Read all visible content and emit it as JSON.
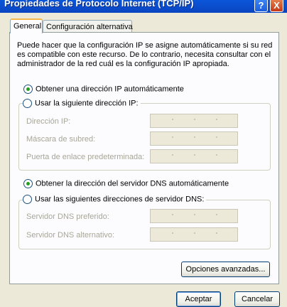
{
  "window": {
    "title": "Propiedades de Protocolo Internet (TCP/IP)",
    "help_glyph": "?",
    "close_glyph": "X"
  },
  "tabs": [
    {
      "label": "General",
      "active": true
    },
    {
      "label": "Configuración alternativa",
      "active": false
    }
  ],
  "description": "Puede hacer que la configuración IP se asigne automáticamente si su red es compatible con este recurso. De lo contrario, necesita consultar con el administrador de la red cuál es la configuración IP apropiada.",
  "ip_options": {
    "auto_label": "Obtener una dirección IP automáticamente",
    "auto_selected": true,
    "manual_label": "Usar la siguiente dirección IP:",
    "manual_selected": false,
    "fields": [
      {
        "label": "Dirección IP:",
        "value": ""
      },
      {
        "label": "Máscara de subred:",
        "value": ""
      },
      {
        "label": "Puerta de enlace predeterminada:",
        "value": ""
      }
    ]
  },
  "dns_options": {
    "auto_label": "Obtener la dirección del servidor DNS automáticamente",
    "auto_selected": true,
    "manual_label": "Usar las siguientes direcciones de servidor DNS:",
    "manual_selected": false,
    "fields": [
      {
        "label": "Servidor DNS preferido:",
        "value": ""
      },
      {
        "label": "Servidor DNS alternativo:",
        "value": ""
      }
    ]
  },
  "buttons": {
    "advanced": "Opciones avanzadas...",
    "ok": "Aceptar",
    "cancel": "Cancelar"
  },
  "colors": {
    "titlebar": "#0a4fd0",
    "dialog_bg": "#ece9d8",
    "radio_selected": "#21a121",
    "disabled_text": "#a7a697"
  }
}
